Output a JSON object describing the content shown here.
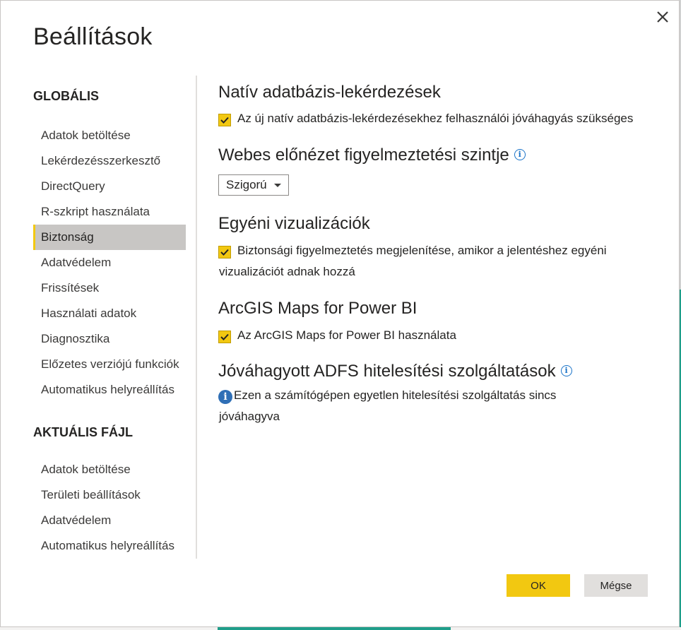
{
  "dialog": {
    "title": "Beállítások",
    "close_icon": "close-icon",
    "accent_color": "#f2c811"
  },
  "sidebar": {
    "global_header": "GLOBÁLIS",
    "global_items": [
      {
        "label": "Adatok betöltése"
      },
      {
        "label": "Lekérdezésszerkesztő"
      },
      {
        "label": "DirectQuery"
      },
      {
        "label": "R-szkript használata"
      },
      {
        "label": "Biztonság",
        "selected": true
      },
      {
        "label": "Adatvédelem"
      },
      {
        "label": "Frissítések"
      },
      {
        "label": "Használati adatok"
      },
      {
        "label": "Diagnosztika"
      },
      {
        "label": "Előzetes verziójú funkciók"
      },
      {
        "label": "Automatikus helyreállítás"
      }
    ],
    "file_header": "AKTUÁLIS FÁJL",
    "file_items": [
      {
        "label": "Adatok betöltése"
      },
      {
        "label": "Területi beállítások"
      },
      {
        "label": "Adatvédelem"
      },
      {
        "label": "Automatikus helyreállítás"
      }
    ]
  },
  "content": {
    "native_queries": {
      "heading": "Natív adatbázis-lekérdezések",
      "checkbox_label": "Az új natív adatbázis-lekérdezésekhez felhasználói jóváhagyás szükséges",
      "checked": true
    },
    "web_preview": {
      "heading": "Webes előnézet figyelmeztetési szintje",
      "info_icon": "info-icon",
      "dropdown_value": "Szigorú"
    },
    "custom_visuals": {
      "heading": "Egyéni vizualizációk",
      "checkbox_label_line1": "Biztonsági figyelmeztetés megjelenítése, amikor a jelentéshez egyéni",
      "checkbox_label_line2": "vizualizációt adnak hozzá",
      "checked": true
    },
    "arcgis": {
      "heading": "ArcGIS Maps for Power BI",
      "checkbox_label": "Az ArcGIS Maps for Power BI használata",
      "checked": true
    },
    "adfs": {
      "heading": "Jóváhagyott ADFS hitelesítési szolgáltatások",
      "info_icon": "info-icon",
      "message_line1": "Ezen a számítógépen egyetlen hitelesítési szolgáltatás sincs",
      "message_line2": "jóváhagyva"
    }
  },
  "footer": {
    "ok_label": "OK",
    "cancel_label": "Mégse"
  }
}
